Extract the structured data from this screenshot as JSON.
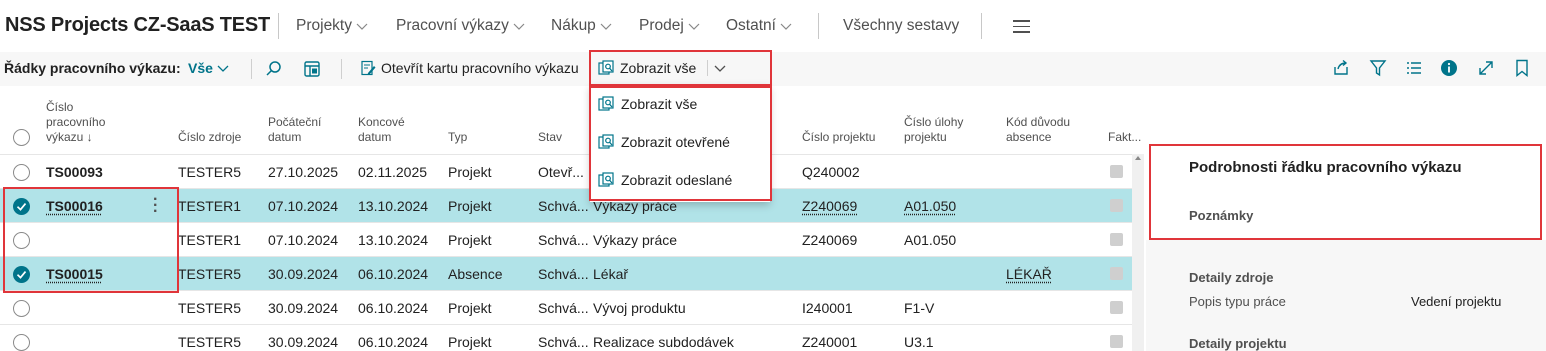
{
  "app": {
    "title": "NSS Projects CZ-SaaS TEST"
  },
  "nav": {
    "items": [
      "Projekty",
      "Pracovní výkazy",
      "Nákup",
      "Prodej",
      "Ostatní"
    ],
    "all_reports": "Všechny sestavy",
    "menu_icon": "hamburger-icon"
  },
  "actionbar": {
    "label": "Řádky pracovního výkazu:",
    "filter": "Vše",
    "open_card": "Otevřít kartu pracovního výkazu",
    "show_all": "Zobrazit vše",
    "icons": [
      "search-icon",
      "filter-pane-icon",
      "share-icon",
      "funnel-icon",
      "list-icon",
      "info-icon",
      "expand-icon",
      "bookmark-icon"
    ]
  },
  "dropdown": {
    "items": [
      "Zobrazit vše",
      "Zobrazit otevřené",
      "Zobrazit odeslané"
    ]
  },
  "grid": {
    "headers": {
      "doc_no": [
        "Číslo",
        "pracovního",
        "výkazu ↓"
      ],
      "resource": "Číslo zdroje",
      "start": [
        "Počáteční",
        "datum"
      ],
      "end": [
        "Koncové",
        "datum"
      ],
      "type": "Typ",
      "status": "Stav",
      "project": "Číslo projektu",
      "task": [
        "Číslo úlohy",
        "projektu"
      ],
      "absence": [
        "Kód důvodu",
        "absence"
      ],
      "billable": "Fakt..."
    },
    "rows": [
      {
        "doc": "TS00093",
        "res": "TESTER5",
        "start": "27.10.2025",
        "end": "02.11.2025",
        "type": "Projekt",
        "status": "Otevř...",
        "desc": "",
        "project": "Q240002",
        "task": "",
        "absence": "",
        "selected": false
      },
      {
        "doc": "TS00016",
        "res": "TESTER1",
        "start": "07.10.2024",
        "end": "13.10.2024",
        "type": "Projekt",
        "status": "Schvá...",
        "desc": "Výkazy práce",
        "project": "Z240069",
        "task": "A01.050",
        "absence": "",
        "selected": true
      },
      {
        "doc": "",
        "res": "TESTER1",
        "start": "07.10.2024",
        "end": "13.10.2024",
        "type": "Projekt",
        "status": "Schvá...",
        "desc": "Výkazy práce",
        "project": "Z240069",
        "task": "A01.050",
        "absence": "",
        "selected": false
      },
      {
        "doc": "TS00015",
        "res": "TESTER5",
        "start": "30.09.2024",
        "end": "06.10.2024",
        "type": "Absence",
        "status": "Schvá...",
        "desc": "Lékař",
        "project": "",
        "task": "",
        "absence": "LÉKAŘ",
        "selected": true
      },
      {
        "doc": "",
        "res": "TESTER5",
        "start": "30.09.2024",
        "end": "06.10.2024",
        "type": "Projekt",
        "status": "Schvá...",
        "desc": "Vývoj produktu",
        "project": "I240001",
        "task": "F1-V",
        "absence": "",
        "selected": false
      },
      {
        "doc": "",
        "res": "TESTER5",
        "start": "30.09.2024",
        "end": "06.10.2024",
        "type": "Projekt",
        "status": "Schvá...",
        "desc": "Realizace subdodávek",
        "project": "Z240001",
        "task": "U3.1",
        "absence": "",
        "selected": false
      }
    ]
  },
  "factbox": {
    "title": "Podrobnosti řádku pracovního výkazu",
    "notes": "Poznámky",
    "resource_details": "Detaily zdroje",
    "work_type_label": "Popis typu práce",
    "work_type_value": "Vedení projektu",
    "project_details": "Detaily projektu"
  },
  "colors": {
    "accent": "#00748a",
    "selected_row": "#b1e3e8",
    "highlight": "#e0353a"
  }
}
